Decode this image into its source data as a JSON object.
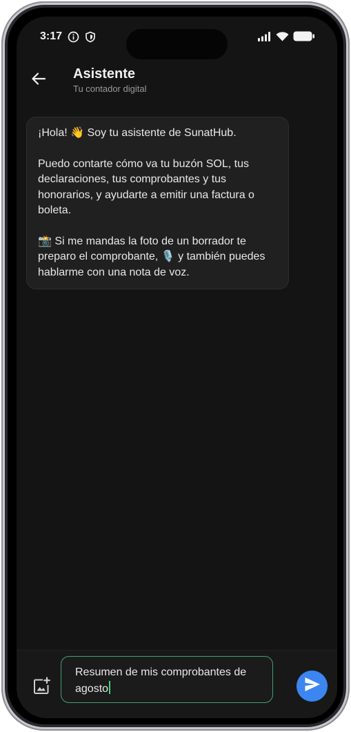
{
  "status_bar": {
    "time": "3:17",
    "icons": [
      "info-icon",
      "shield-icon",
      "signal-icon",
      "wifi-icon",
      "battery-icon"
    ]
  },
  "header": {
    "title": "Asistente",
    "subtitle": "Tu contador digital",
    "back_icon": "arrow-left-icon"
  },
  "chat": {
    "messages": [
      {
        "role": "assistant",
        "paragraphs": [
          "¡Hola! 👋 Soy tu asistente de SunatHub.",
          "Puedo contarte cómo va tu buzón SOL, tus declaraciones, tus comprobantes y tus honorarios, y ayudarte a emitir una factura o boleta.",
          "📸 Si me mandas la foto de un borrador te preparo el comprobante, 🎙️ y también puedes hablarme con una nota de voz."
        ]
      }
    ]
  },
  "composer": {
    "input_value": "Resumen de mis comprobantes de agosto",
    "attach_icon": "add-photo-icon",
    "send_icon": "send-icon"
  },
  "colors": {
    "background": "#141414",
    "bubble": "#202020",
    "input_border": "#3fa372",
    "send_button": "#3b86f0"
  }
}
